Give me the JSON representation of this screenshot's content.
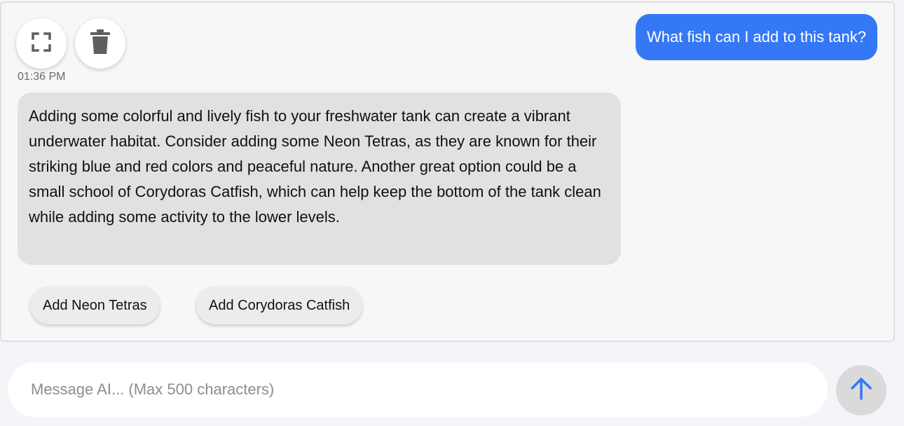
{
  "toolbar": {
    "expand_icon": "fullscreen-icon",
    "delete_icon": "trash-icon"
  },
  "conversation": {
    "timestamp": "01:36 PM",
    "user_message": "What fish can I add to this tank?",
    "ai_message": "Adding some colorful and lively fish to your freshwater tank can create a vibrant underwater habitat. Consider adding some Neon Tetras, as they are known for their striking blue and red colors and peaceful nature. Another great option could be a small school of Corydoras Catfish, which can help keep the bottom of the tank clean while adding some activity to the lower levels.",
    "suggestions": [
      {
        "label": "Add Neon Tetras"
      },
      {
        "label": "Add Corydoras Catfish"
      }
    ]
  },
  "composer": {
    "placeholder": "Message AI... (Max 500 characters)",
    "value": "",
    "send_icon": "arrow-up-icon"
  },
  "colors": {
    "user_bubble": "#3478f6",
    "ai_bubble": "#e1e1e1",
    "send_arrow": "#3478f6",
    "send_button_bg": "#dadada"
  }
}
